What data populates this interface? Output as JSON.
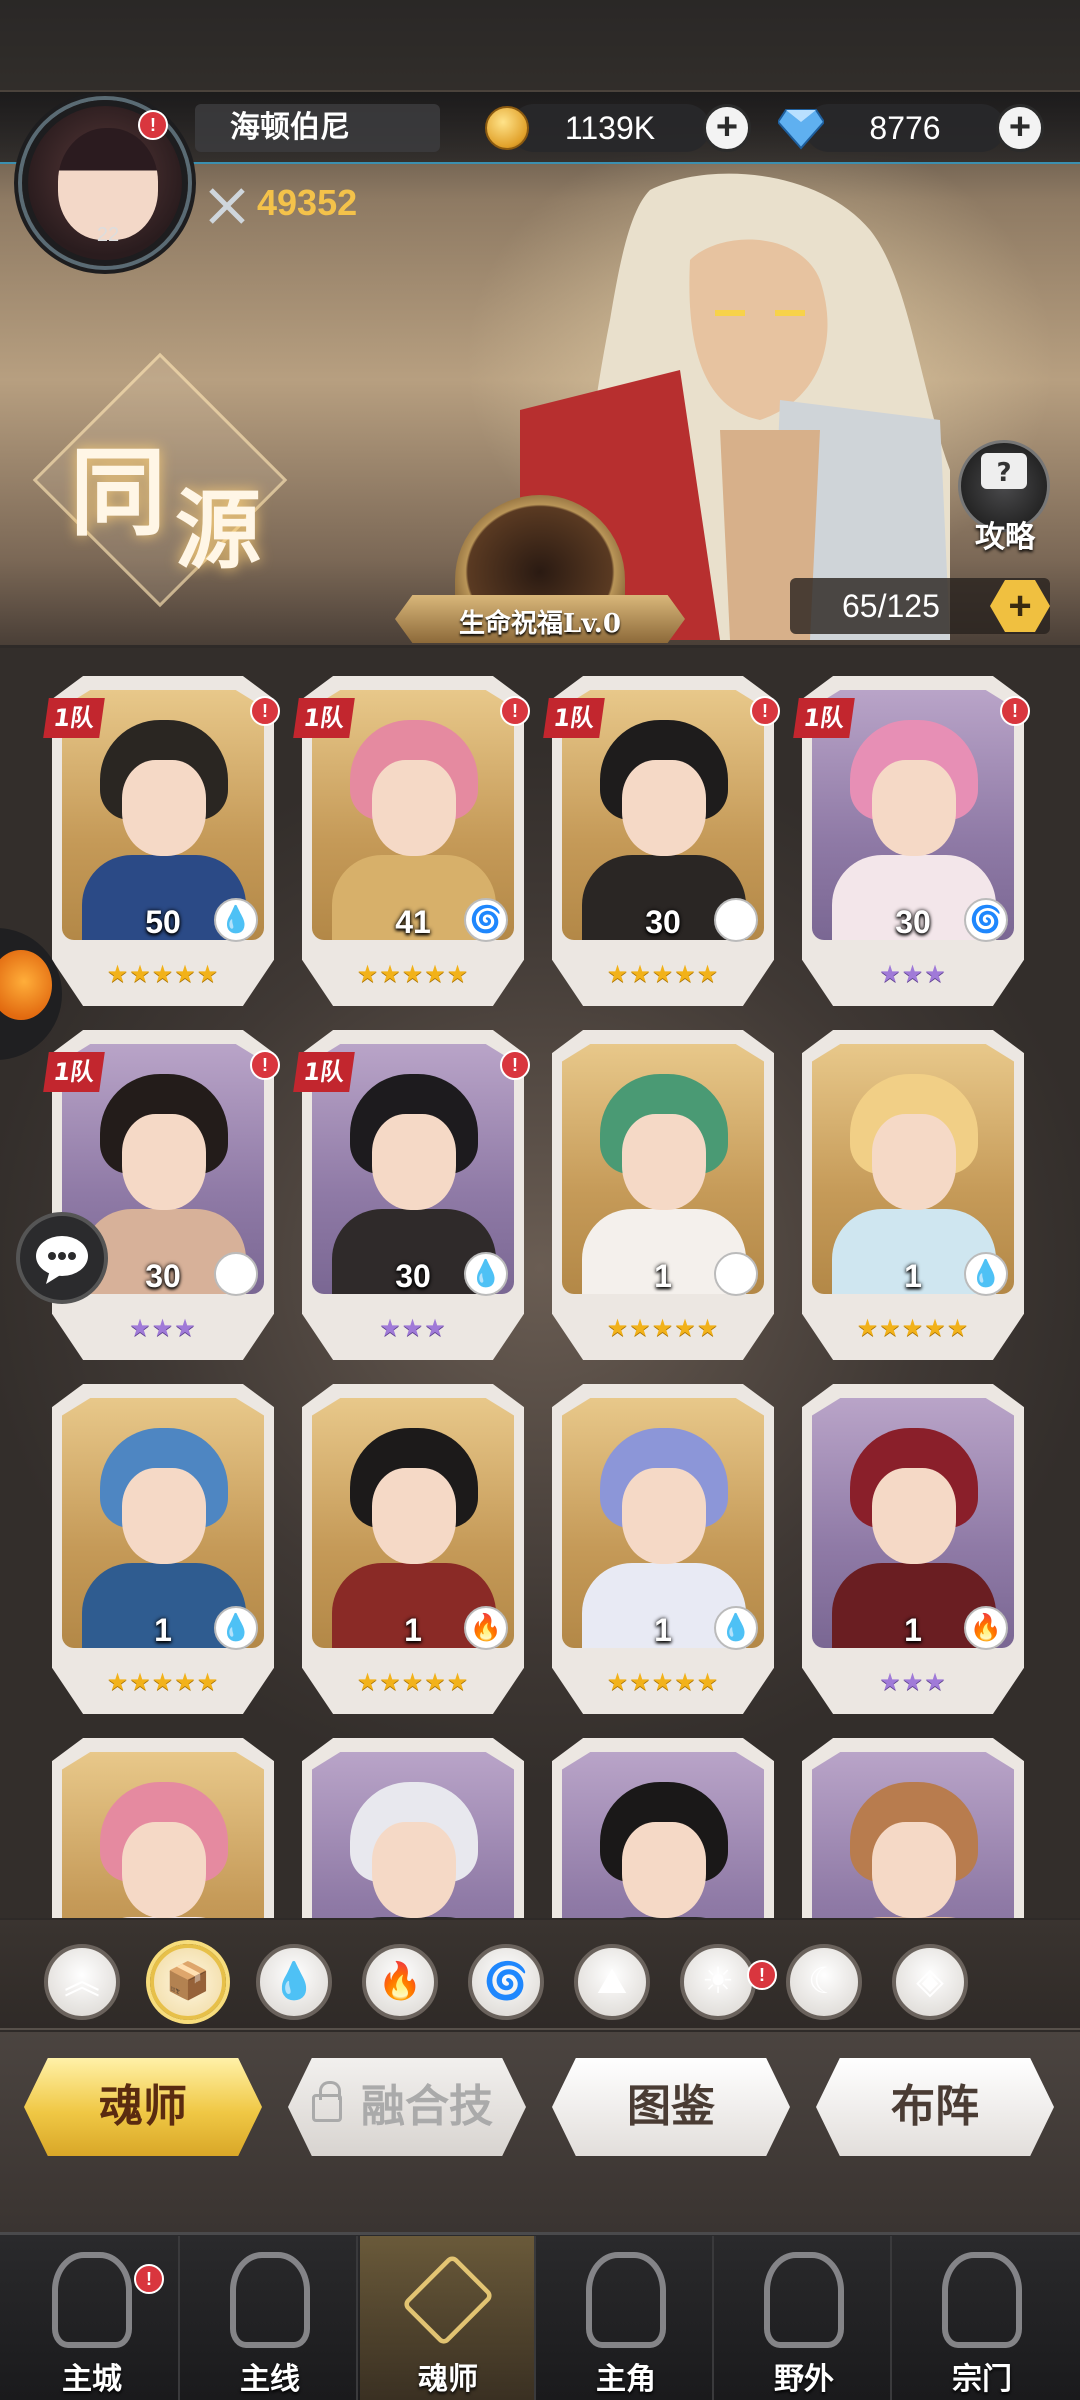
{
  "header": {
    "player_name": "海顿伯尼",
    "player_level": "22",
    "coins": "1139K",
    "gems": "8776",
    "power": "49352",
    "plus_symbol": "+"
  },
  "banner": {
    "title_char_1": "同",
    "title_char_2": "源",
    "guide_label": "攻略",
    "progress": "65/125",
    "blessing": "生命祝福Lv.0"
  },
  "cards": [
    {
      "level": "50",
      "element": "water",
      "element_glyph": "💧",
      "stars": "★★★★★",
      "star_color": "gold",
      "team": "1队",
      "alert": true,
      "bg": "gold",
      "hair": "#2a2622",
      "body": "#2b4a86"
    },
    {
      "level": "41",
      "element": "wind",
      "element_glyph": "🌀",
      "stars": "★★★★★",
      "star_color": "gold",
      "team": "1队",
      "alert": true,
      "bg": "gold",
      "hair": "#e58aa0",
      "body": "#d7b06a"
    },
    {
      "level": "30",
      "element": "earth",
      "element_glyph": "⛰",
      "stars": "★★★★★",
      "star_color": "gold",
      "team": "1队",
      "alert": true,
      "bg": "gold",
      "hair": "#1e1c1c",
      "body": "#2a2624"
    },
    {
      "level": "30",
      "element": "wind",
      "element_glyph": "🌀",
      "stars": "★★★",
      "star_color": "purple",
      "team": "1队",
      "alert": true,
      "bg": "purple",
      "hair": "#e78fb5",
      "body": "#f3e6ea"
    },
    {
      "level": "30",
      "element": "earth",
      "element_glyph": "⛰",
      "stars": "★★★",
      "star_color": "purple",
      "team": "1队",
      "alert": true,
      "bg": "purple",
      "hair": "#231c1a",
      "body": "#d7b199"
    },
    {
      "level": "30",
      "element": "water",
      "element_glyph": "💧",
      "stars": "★★★",
      "star_color": "purple",
      "team": "1队",
      "alert": true,
      "bg": "purple",
      "hair": "#1d1b1e",
      "body": "#2f2a2a"
    },
    {
      "level": "1",
      "element": "light",
      "element_glyph": "☀",
      "stars": "★★★★★",
      "star_color": "gold",
      "team": "",
      "alert": false,
      "bg": "gold",
      "hair": "#4a9a74",
      "body": "#f4f0ec"
    },
    {
      "level": "1",
      "element": "water",
      "element_glyph": "💧",
      "stars": "★★★★★",
      "star_color": "gold",
      "team": "",
      "alert": false,
      "bg": "gold",
      "hair": "#f1cf86",
      "body": "#cfe6f0"
    },
    {
      "level": "1",
      "element": "water",
      "element_glyph": "💧",
      "stars": "★★★★★",
      "star_color": "gold",
      "team": "",
      "alert": false,
      "bg": "gold",
      "hair": "#4e86c2",
      "body": "#2f5c90"
    },
    {
      "level": "1",
      "element": "fire",
      "element_glyph": "🔥",
      "stars": "★★★★★",
      "star_color": "gold",
      "team": "",
      "alert": false,
      "bg": "gold",
      "hair": "#1c1a1a",
      "body": "#8a2a26"
    },
    {
      "level": "1",
      "element": "water",
      "element_glyph": "💧",
      "stars": "★★★★★",
      "star_color": "gold",
      "team": "",
      "alert": false,
      "bg": "gold",
      "hair": "#8c96d8",
      "body": "#e8eaf4"
    },
    {
      "level": "1",
      "element": "fire",
      "element_glyph": "🔥",
      "stars": "★★★",
      "star_color": "purple",
      "team": "",
      "alert": false,
      "bg": "purple",
      "hair": "#8a1f2a",
      "body": "#6a1e22"
    },
    {
      "level": "",
      "element": "",
      "element_glyph": "",
      "stars": "",
      "star_color": "gold",
      "team": "",
      "alert": false,
      "bg": "gold",
      "hair": "#e58aa0",
      "body": "#f3e6ea"
    },
    {
      "level": "",
      "element": "",
      "element_glyph": "",
      "stars": "",
      "star_color": "purple",
      "team": "",
      "alert": false,
      "bg": "purple",
      "hair": "#e8e8ee",
      "body": "#2a2a30"
    },
    {
      "level": "",
      "element": "",
      "element_glyph": "",
      "stars": "",
      "star_color": "gold",
      "team": "",
      "alert": false,
      "bg": "purple",
      "hair": "#1a1818",
      "body": "#2a2a2a"
    },
    {
      "level": "",
      "element": "",
      "element_glyph": "",
      "stars": "",
      "star_color": "gold",
      "team": "",
      "alert": false,
      "bg": "purple",
      "hair": "#b87c4e",
      "body": "#d9b49a"
    }
  ],
  "filters": [
    {
      "name": "rank-up",
      "glyph": "︽",
      "active": false
    },
    {
      "name": "all",
      "glyph": "📦",
      "active": true
    },
    {
      "name": "water",
      "glyph": "💧",
      "active": false
    },
    {
      "name": "fire",
      "glyph": "🔥",
      "active": false
    },
    {
      "name": "wind",
      "glyph": "🌀",
      "active": false
    },
    {
      "name": "earth",
      "glyph": "⛰",
      "active": false
    },
    {
      "name": "light",
      "glyph": "☀",
      "active": false
    },
    {
      "name": "dark",
      "glyph": "☾",
      "active": false
    },
    {
      "name": "void",
      "glyph": "◈",
      "active": false
    }
  ],
  "tabs": {
    "soul_master": "魂师",
    "fusion": "融合技",
    "codex": "图鉴",
    "formation": "布阵"
  },
  "nav": {
    "main_city": "主城",
    "main_line": "主线",
    "soul_master": "魂师",
    "protagonist": "主角",
    "wild": "野外",
    "sect": "宗门"
  },
  "alert_mark": "!"
}
